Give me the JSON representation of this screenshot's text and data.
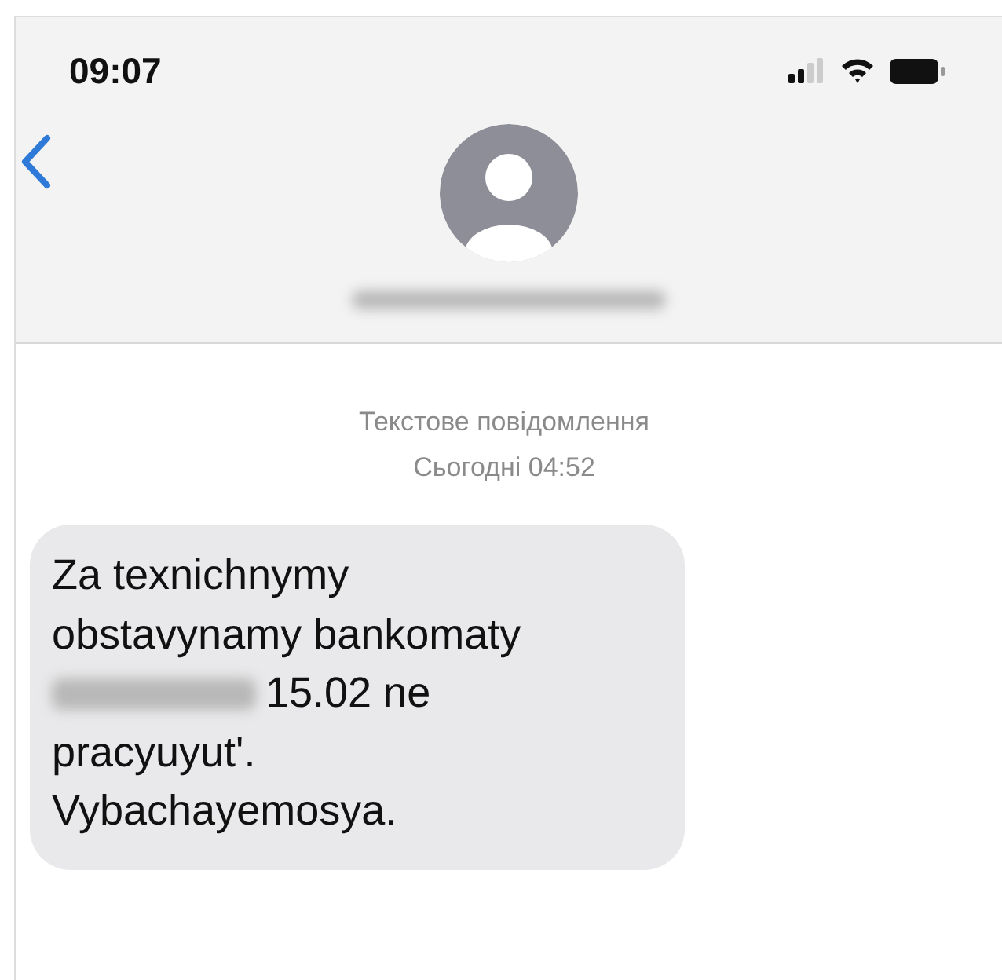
{
  "status_bar": {
    "time": "09:07"
  },
  "header": {
    "contact_redacted": true
  },
  "thread": {
    "label": "Текстове повідомлення",
    "time": "Сьогодні 04:52"
  },
  "messages": [
    {
      "kind": "received",
      "lines": [
        {
          "text": "Za texnichnymy",
          "redacted_before": false
        },
        {
          "text": "obstavynamy bankomaty",
          "redacted_before": false
        },
        {
          "text": "15.02 ne",
          "redacted_before": true
        },
        {
          "text": "pracyuyut'.",
          "redacted_before": false
        },
        {
          "text": "Vybachayemosya.",
          "redacted_before": false
        }
      ]
    }
  ]
}
